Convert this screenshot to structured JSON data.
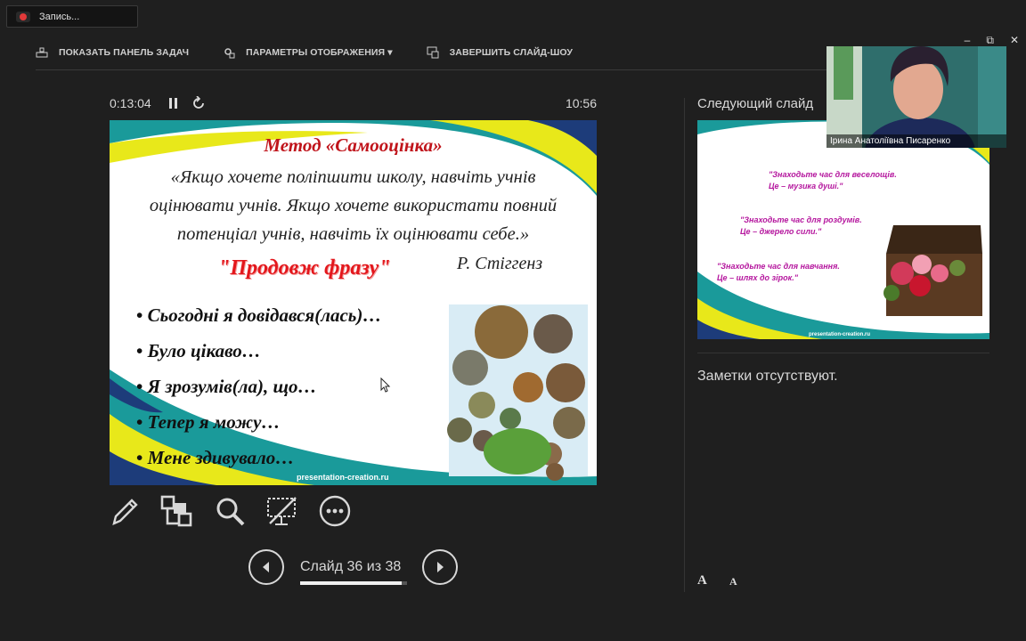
{
  "recording": {
    "label": "Запись..."
  },
  "toolbar": {
    "show_taskbar": "ПОКАЗАТЬ ПАНЕЛЬ ЗАДАЧ",
    "display_settings": "ПАРАМЕТРЫ ОТОБРАЖЕНИЯ ▾",
    "end_show": "ЗАВЕРШИТЬ СЛАЙД-ШОУ"
  },
  "window_controls": {
    "minimize": "–",
    "restore": "⧉",
    "close": "✕"
  },
  "timer": {
    "elapsed": "0:13:04",
    "clock": "10:56"
  },
  "current_slide": {
    "title": "Метод «Самооцінка»",
    "quote_lines": [
      "«Якщо хочете поліпшити школу, навчіть учнів",
      "оцінювати учнів. Якщо хочете використати повний",
      "потенціал учнів, навчіть їх оцінювати себе.»"
    ],
    "author": "Р. Стіггенз",
    "subtitle": "\"Продовж фразу\"",
    "bullets": [
      "Сьогодні я довідався(лась)…",
      "Було цікаво…",
      "Я зрозумів(ла), що…",
      "Тепер я можу…",
      "Мене здивувало…"
    ],
    "footer": "presentation-creation.ru",
    "colors": {
      "title": "#c0141b",
      "subtitle": "#e3171c",
      "teal": "#1a9a9a",
      "yellow": "#e8e81a",
      "navy": "#1d3c7a"
    }
  },
  "next_slide": {
    "label": "Следующий слайд",
    "quotes": [
      {
        "line1": "\"Знаходьте час для веселощів.",
        "line2": "Це – музика душі.\""
      },
      {
        "line1": "\"Знаходьте час для роздумів.",
        "line2": "Це – джерело сили.\""
      },
      {
        "line1": "\"Знаходьте час для навчання.",
        "line2": "Це – шлях до зірок.\""
      }
    ],
    "footer": "presentation-creation.ru"
  },
  "notes": {
    "text": "Заметки отсутствуют.",
    "font_increase": "A",
    "font_decrease": "A"
  },
  "tools": [
    "pen-icon",
    "slides-grid-icon",
    "zoom-icon",
    "black-screen-icon",
    "more-icon"
  ],
  "navigation": {
    "counter": "Слайд 36 из 38",
    "progress": 0.947
  },
  "webcam": {
    "name": "Ірина Анатоліївна Писаренко"
  }
}
